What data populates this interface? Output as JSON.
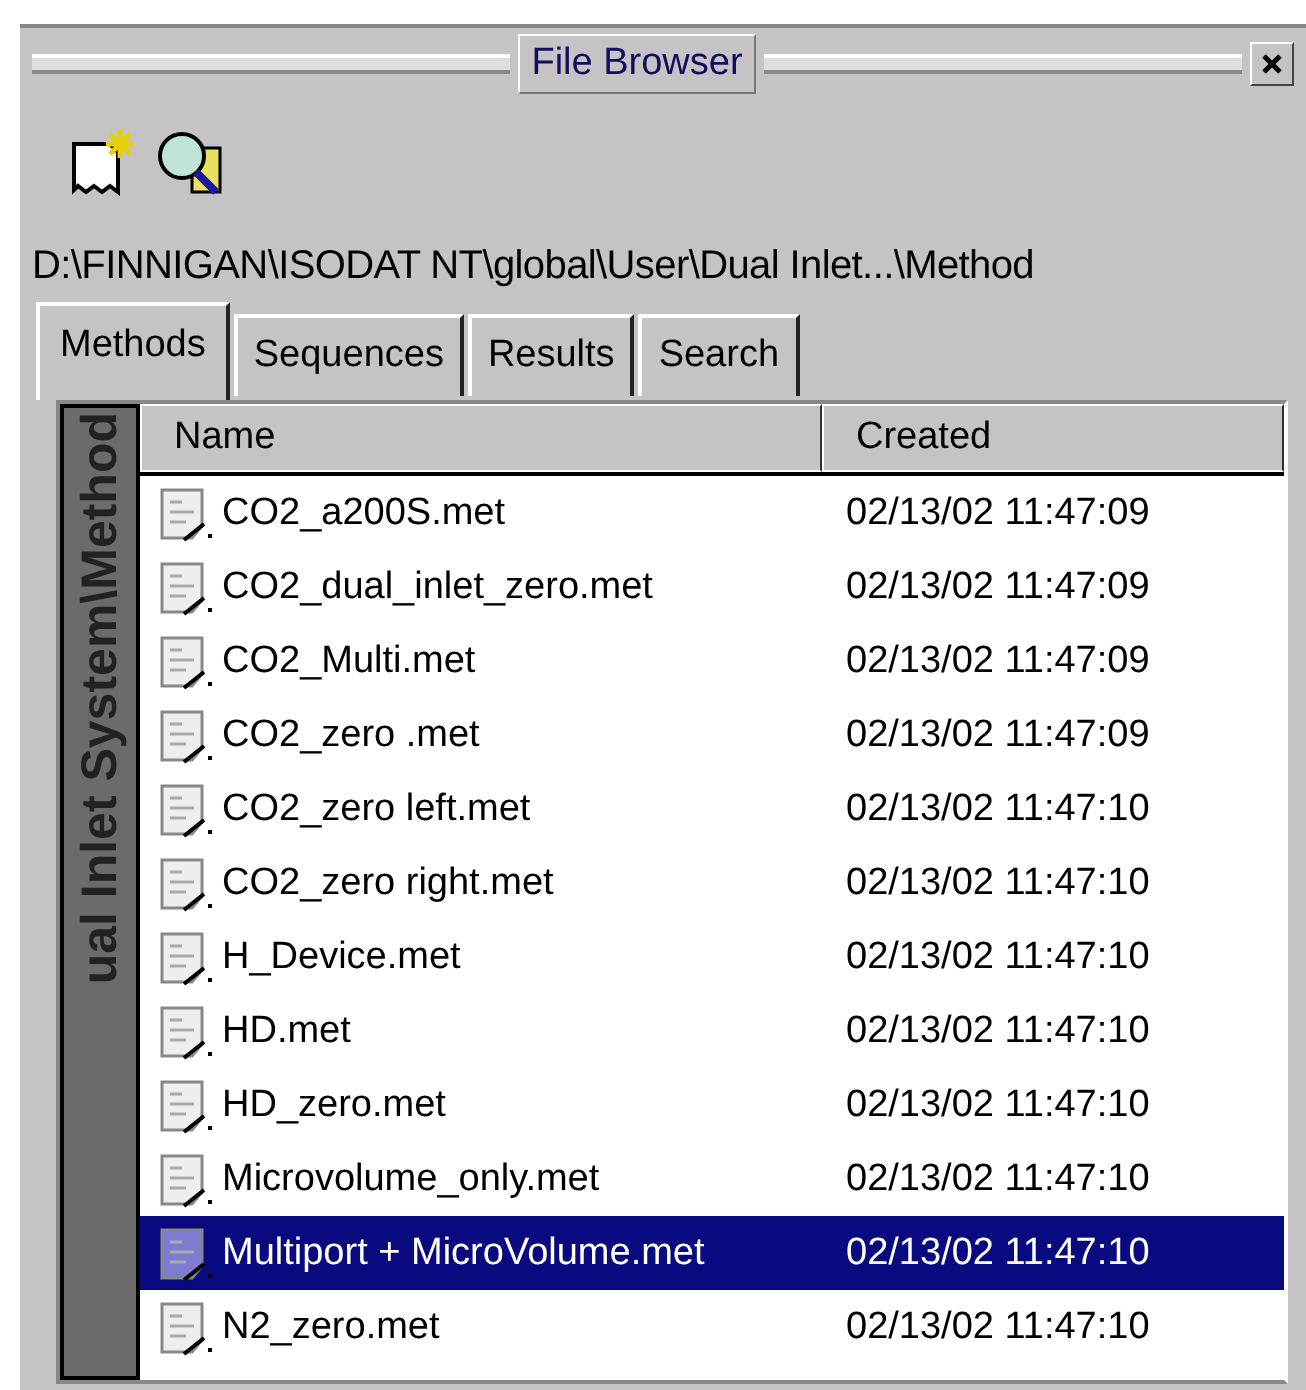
{
  "window": {
    "title": "File Browser"
  },
  "path": "D:\\FINNIGAN\\ISODAT NT\\global\\User\\Dual Inlet...\\Method",
  "tabs": [
    {
      "label": "Methods",
      "selected": true
    },
    {
      "label": "Sequences",
      "selected": false
    },
    {
      "label": "Results",
      "selected": false
    },
    {
      "label": "Search",
      "selected": false
    }
  ],
  "side_label": "ual Inlet System\\Method",
  "table": {
    "columns": [
      "Name",
      "Created"
    ],
    "rows": [
      {
        "name": "CO2_a200S.met",
        "created": "02/13/02 11:47:09",
        "selected": false
      },
      {
        "name": "CO2_dual_inlet_zero.met",
        "created": "02/13/02 11:47:09",
        "selected": false
      },
      {
        "name": "CO2_Multi.met",
        "created": "02/13/02 11:47:09",
        "selected": false
      },
      {
        "name": "CO2_zero .met",
        "created": "02/13/02 11:47:09",
        "selected": false
      },
      {
        "name": "CO2_zero left.met",
        "created": "02/13/02 11:47:10",
        "selected": false
      },
      {
        "name": "CO2_zero right.met",
        "created": "02/13/02 11:47:10",
        "selected": false
      },
      {
        "name": "H_Device.met",
        "created": "02/13/02 11:47:10",
        "selected": false
      },
      {
        "name": "HD.met",
        "created": "02/13/02 11:47:10",
        "selected": false
      },
      {
        "name": "HD_zero.met",
        "created": "02/13/02 11:47:10",
        "selected": false
      },
      {
        "name": "Microvolume_only.met",
        "created": "02/13/02 11:47:10",
        "selected": false
      },
      {
        "name": "Multiport + MicroVolume.met",
        "created": "02/13/02 11:47:10",
        "selected": true
      },
      {
        "name": "N2_zero.met",
        "created": "02/13/02 11:47:10",
        "selected": false
      }
    ]
  }
}
